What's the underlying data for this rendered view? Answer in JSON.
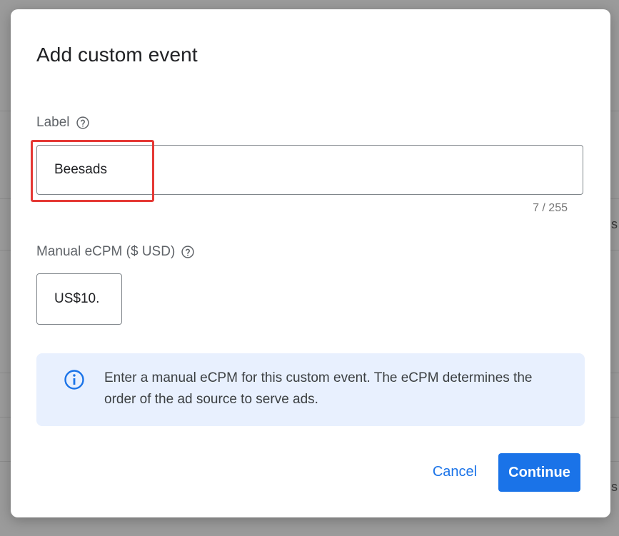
{
  "dialog": {
    "title": "Add custom event",
    "label_field": {
      "label": "Label",
      "value": "Beesads",
      "counter": "7 / 255"
    },
    "ecpm_field": {
      "label": "Manual eCPM ($ USD)",
      "value": "US$10."
    },
    "info": {
      "icon": "info-icon",
      "text": "Enter a manual eCPM for this custom event. The eCPM determines the order of the ad source to serve ads."
    },
    "buttons": {
      "cancel": "Cancel",
      "continue": "Continue"
    }
  },
  "background": {
    "edge_letters": [
      "s",
      "s"
    ]
  },
  "colors": {
    "primary": "#1a73e8",
    "info_bg": "#e8f0fe",
    "highlight": "#e53935"
  }
}
